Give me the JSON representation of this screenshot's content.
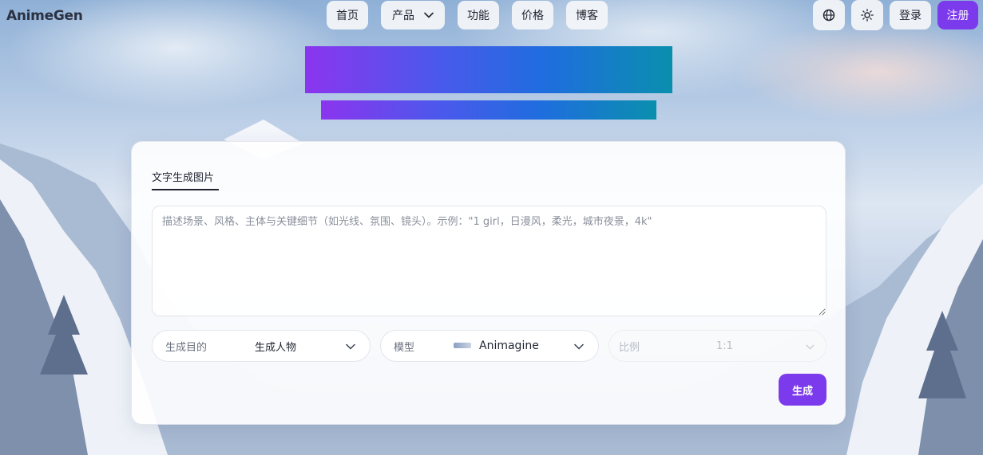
{
  "brand": {
    "logo": "AnimeGen"
  },
  "nav": {
    "home": "首页",
    "products": "产品",
    "features": "功能",
    "pricing": "价格",
    "blog": "博客"
  },
  "actions": {
    "login": "登录",
    "signup": "注册"
  },
  "icons": {
    "language": "globe-icon",
    "theme": "sun-icon",
    "dropdown": "chevron-down-icon"
  },
  "colors": {
    "accent": "#7c3aed",
    "gradient_start": "#8b35ee",
    "gradient_end": "#0a8fae"
  },
  "generator": {
    "tab_label": "文字生成图片",
    "prompt": {
      "value": "",
      "placeholder": "描述场景、风格、主体与关键细节（如光线、氛围、镜头）。示例：\"1 girl，日漫风，柔光，城市夜景，4k\""
    },
    "purpose": {
      "label": "生成目的",
      "value": "生成人物"
    },
    "model": {
      "label": "模型",
      "value": "Animagine"
    },
    "ratio": {
      "label": "比例",
      "value": "1:1"
    },
    "submit_label": "生成"
  }
}
